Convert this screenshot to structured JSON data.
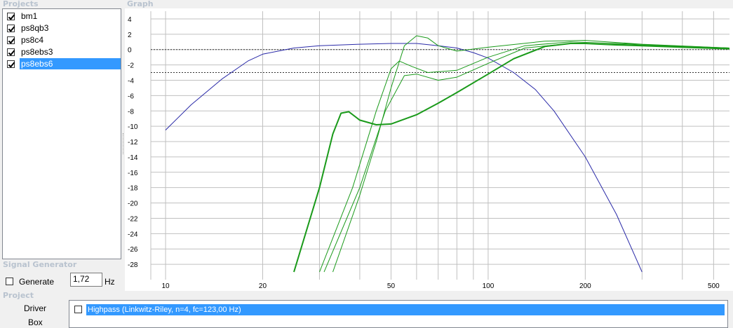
{
  "projects": {
    "title": "Projects",
    "items": [
      {
        "label": "bm1",
        "checked": true,
        "selected": false
      },
      {
        "label": "ps8qb3",
        "checked": true,
        "selected": false
      },
      {
        "label": "ps8c4",
        "checked": true,
        "selected": false
      },
      {
        "label": "ps8ebs3",
        "checked": true,
        "selected": false
      },
      {
        "label": "ps8ebs6",
        "checked": true,
        "selected": true
      }
    ]
  },
  "graph": {
    "title": "Graph"
  },
  "signal_generator": {
    "title": "Signal Generator",
    "generate_label": "Generate",
    "generate_checked": false,
    "frequency_value": "1,72",
    "frequency_unit": "Hz"
  },
  "project": {
    "title": "Project",
    "driver_label": "Driver",
    "box_label": "Box",
    "filters": [
      {
        "label": "Highpass (Linkwitz-Riley, n=4, fc=123,00 Hz)",
        "checked": false
      }
    ]
  },
  "colors": {
    "accent": "#3399ff",
    "green": "#1a9a1a",
    "blue": "#2a2aa8"
  },
  "chart_data": {
    "type": "line",
    "xscale": "log",
    "xlim": [
      9,
      560
    ],
    "ylim": [
      -30,
      5
    ],
    "x_ticks": [
      10,
      20,
      50,
      100,
      200,
      500
    ],
    "y_ticks": [
      4,
      2,
      0,
      -2,
      -4,
      -6,
      -8,
      -10,
      -12,
      -14,
      -16,
      -18,
      -20,
      -22,
      -24,
      -26,
      -28
    ],
    "reference_lines": [
      0,
      -3
    ],
    "series": [
      {
        "color": "#2a2aa8",
        "width": 1,
        "points": [
          [
            10,
            -10.5
          ],
          [
            12,
            -7.2
          ],
          [
            15,
            -3.8
          ],
          [
            18,
            -1.5
          ],
          [
            20,
            -0.6
          ],
          [
            25,
            0.2
          ],
          [
            30,
            0.5
          ],
          [
            40,
            0.7
          ],
          [
            50,
            0.8
          ],
          [
            60,
            0.8
          ],
          [
            70,
            0.5
          ],
          [
            80,
            0.2
          ],
          [
            90,
            -0.4
          ],
          [
            100,
            -1.1
          ],
          [
            120,
            -3
          ],
          [
            140,
            -5.2
          ],
          [
            160,
            -8
          ],
          [
            200,
            -14
          ],
          [
            250,
            -21.5
          ],
          [
            300,
            -29
          ]
        ]
      },
      {
        "color": "#1a9a1a",
        "width": 2,
        "points": [
          [
            25,
            -29
          ],
          [
            30,
            -18
          ],
          [
            33,
            -11
          ],
          [
            35,
            -8.3
          ],
          [
            37,
            -8.1
          ],
          [
            40,
            -9.2
          ],
          [
            45,
            -9.8
          ],
          [
            50,
            -9.7
          ],
          [
            60,
            -8.5
          ],
          [
            70,
            -7
          ],
          [
            80,
            -5.6
          ],
          [
            100,
            -3.2
          ],
          [
            120,
            -1.2
          ],
          [
            150,
            0.4
          ],
          [
            180,
            0.8
          ],
          [
            200,
            0.8
          ],
          [
            250,
            0.6
          ],
          [
            300,
            0.5
          ],
          [
            400,
            0.3
          ],
          [
            560,
            0.1
          ]
        ]
      },
      {
        "color": "#1a9a1a",
        "width": 1,
        "points": [
          [
            33,
            -29
          ],
          [
            40,
            -19
          ],
          [
            45,
            -12
          ],
          [
            50,
            -5
          ],
          [
            55,
            0.5
          ],
          [
            60,
            1.8
          ],
          [
            65,
            1.5
          ],
          [
            70,
            0.5
          ],
          [
            80,
            -0.2
          ],
          [
            100,
            0.3
          ],
          [
            150,
            1.1
          ],
          [
            200,
            1.2
          ],
          [
            300,
            0.7
          ],
          [
            560,
            0.2
          ]
        ]
      },
      {
        "color": "#1a9a1a",
        "width": 1,
        "points": [
          [
            30,
            -29
          ],
          [
            38,
            -18
          ],
          [
            45,
            -8
          ],
          [
            50,
            -2.5
          ],
          [
            53,
            -1.5
          ],
          [
            58,
            -2.2
          ],
          [
            65,
            -3
          ],
          [
            80,
            -2.7
          ],
          [
            100,
            -1
          ],
          [
            130,
            0.5
          ],
          [
            180,
            1
          ],
          [
            250,
            0.8
          ],
          [
            560,
            0.2
          ]
        ]
      },
      {
        "color": "#1a9a1a",
        "width": 1,
        "points": [
          [
            31,
            -29
          ],
          [
            40,
            -18
          ],
          [
            48,
            -8
          ],
          [
            55,
            -3.4
          ],
          [
            60,
            -3.2
          ],
          [
            70,
            -4
          ],
          [
            80,
            -3.6
          ],
          [
            100,
            -1.8
          ],
          [
            130,
            0.2
          ],
          [
            180,
            0.8
          ],
          [
            250,
            0.7
          ],
          [
            560,
            0.2
          ]
        ]
      }
    ]
  }
}
